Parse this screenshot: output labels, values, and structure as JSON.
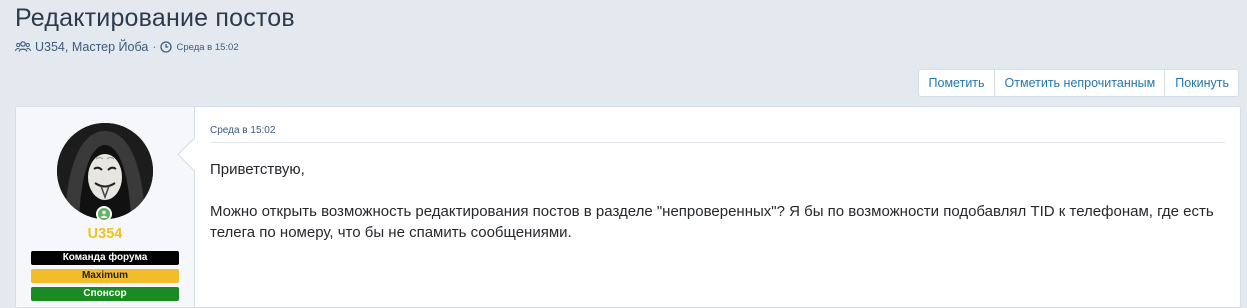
{
  "page": {
    "title": "Редактирование постов",
    "participants": "U354, Мастер Йоба",
    "separator": "·",
    "time": "Среда в 15:02"
  },
  "actions": {
    "mark": "Пометить",
    "mark_unread": "Отметить непрочитанным",
    "leave": "Покинуть"
  },
  "post": {
    "author": {
      "name": "U354",
      "name_color": "#f2c31b",
      "online": true,
      "banners": [
        {
          "label": "Команда форума",
          "bg": "#000000",
          "fg": "#ffffff"
        },
        {
          "label": "Maximum",
          "bg": "#f3bc2a",
          "fg": "#222222"
        },
        {
          "label": "Спонсор",
          "bg": "#1a8b22",
          "fg": "#ffffff"
        }
      ]
    },
    "date": "Среда в 15:02",
    "paragraphs": [
      "Приветствую,",
      "Можно открыть возможность редактирования постов в разделе \"непроверенных\"? Я бы по возможности подобавлял TID к телефонам, где есть телега по номеру, что бы не спамить сообщениями."
    ]
  },
  "icons": {
    "participants": "users-icon",
    "clock": "clock-icon",
    "online": "user-online-icon"
  },
  "colors": {
    "link": "#2577b1",
    "meta": "#3d5a7e",
    "background": "#e4e9ef"
  }
}
